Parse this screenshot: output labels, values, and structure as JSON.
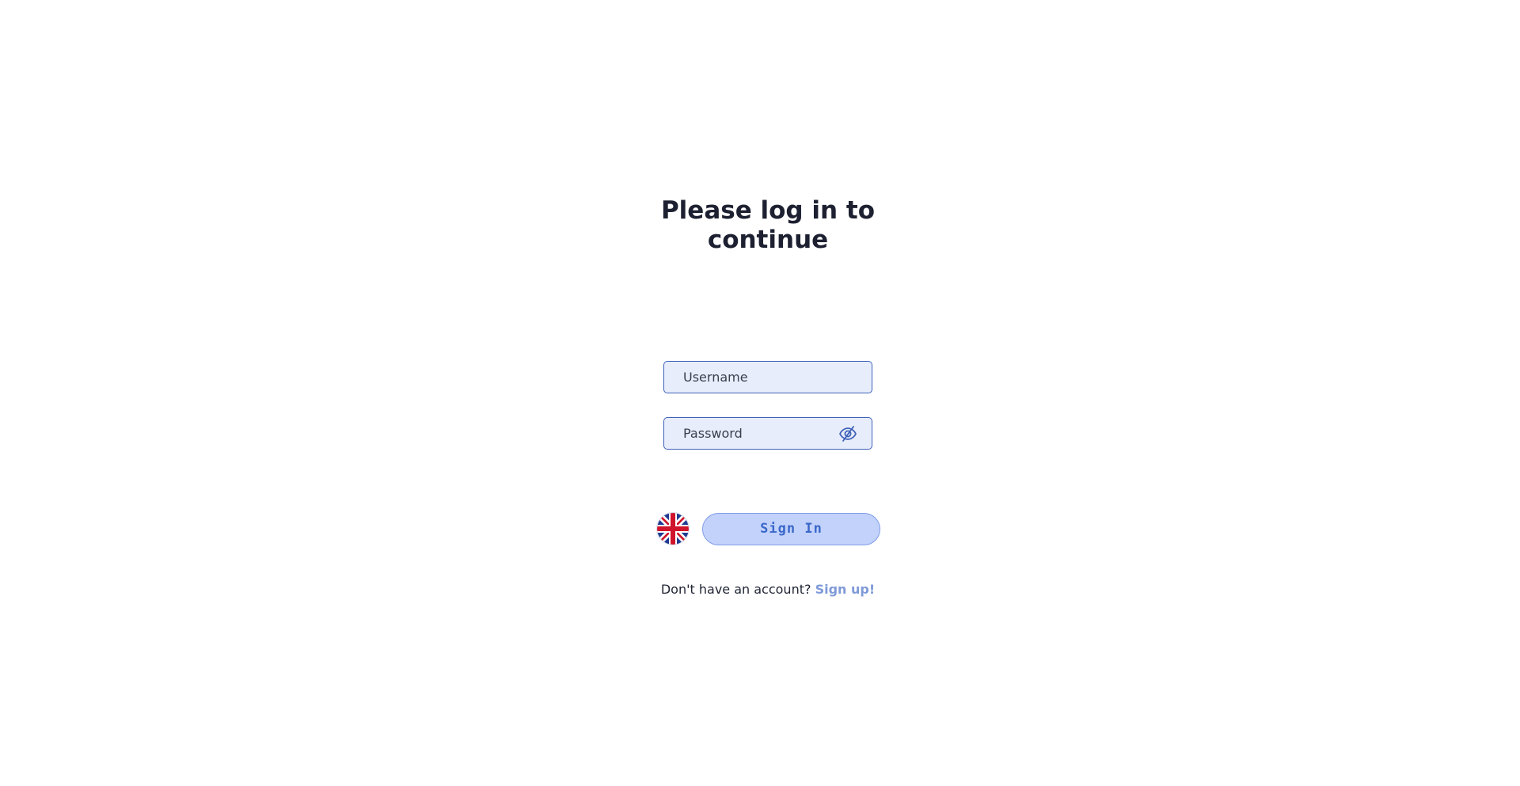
{
  "login": {
    "title": "Please log in to continue",
    "username_placeholder": "Username",
    "username_value": "",
    "password_placeholder": "Password",
    "password_value": "",
    "password_toggle_icon": "eye-off-icon",
    "sign_in_label": "Sign In",
    "signup_prompt": "Don't have an account?",
    "signup_link": "Sign up!",
    "language_icon": "uk-flag-icon"
  },
  "colors": {
    "title": "#1c2030",
    "input_border": "#3e62b8",
    "input_bg": "#e8edfb",
    "button_bg": "#c2d2fb",
    "button_text": "#3a67c9",
    "link": "#7f9ad8"
  }
}
